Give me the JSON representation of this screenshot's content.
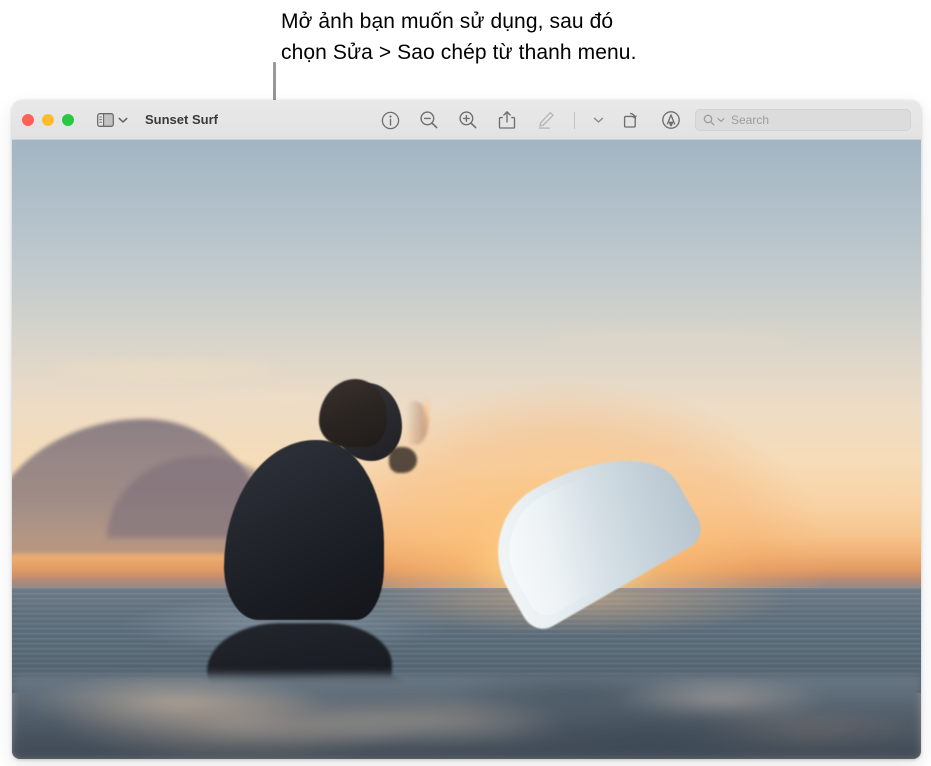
{
  "callout": {
    "text": "Mở ảnh bạn muốn sử dụng, sau đó\nchọn Sửa > Sao chép từ thanh menu.",
    "line_color": "#949494"
  },
  "window": {
    "title": "Sunset Surf",
    "traffic_lights": [
      {
        "name": "close",
        "color": "#ff6159"
      },
      {
        "name": "minimize",
        "color": "#ffbd2e"
      },
      {
        "name": "zoom",
        "color": "#28c840"
      }
    ],
    "sidebar_toggle": {
      "icon": "sidebar-icon",
      "chevron": "chevron-down-icon"
    },
    "toolbar": {
      "buttons": [
        {
          "name": "info-button",
          "icon": "info-circle-icon",
          "enabled": true
        },
        {
          "name": "zoom-out-button",
          "icon": "magnifier-minus-icon",
          "enabled": true
        },
        {
          "name": "zoom-in-button",
          "icon": "magnifier-plus-icon",
          "enabled": true
        },
        {
          "name": "share-button",
          "icon": "share-icon",
          "enabled": true
        },
        {
          "name": "markup-button",
          "icon": "pen-icon",
          "enabled": false
        },
        {
          "name": "markup-menu",
          "icon": "chevron-down-icon",
          "enabled": true
        },
        {
          "name": "rotate-button",
          "icon": "rotate-icon",
          "enabled": true
        },
        {
          "name": "annotate-button",
          "icon": "annotate-circle-icon",
          "enabled": true
        },
        {
          "name": "signature-button",
          "icon": "signature-icon",
          "enabled": false
        }
      ]
    },
    "search": {
      "icon": "search-icon",
      "chevron": "chevron-down-icon",
      "placeholder": "Search",
      "value": ""
    }
  },
  "photo": {
    "description": "Surfer in a black wetsuit sitting on a surfboard in the ocean at sunset, facing right toward the setting sun behind distant hills",
    "colors": {
      "sky_top": "#a3b5c3",
      "sky_mid": "#eddcc6",
      "sun_glow": "#f6c48c",
      "sun": "#ffdf8e",
      "mountain": "#746874",
      "ocean": "#5a6b79",
      "wetsuit": "#191c22",
      "board": "#e6edf1"
    }
  }
}
